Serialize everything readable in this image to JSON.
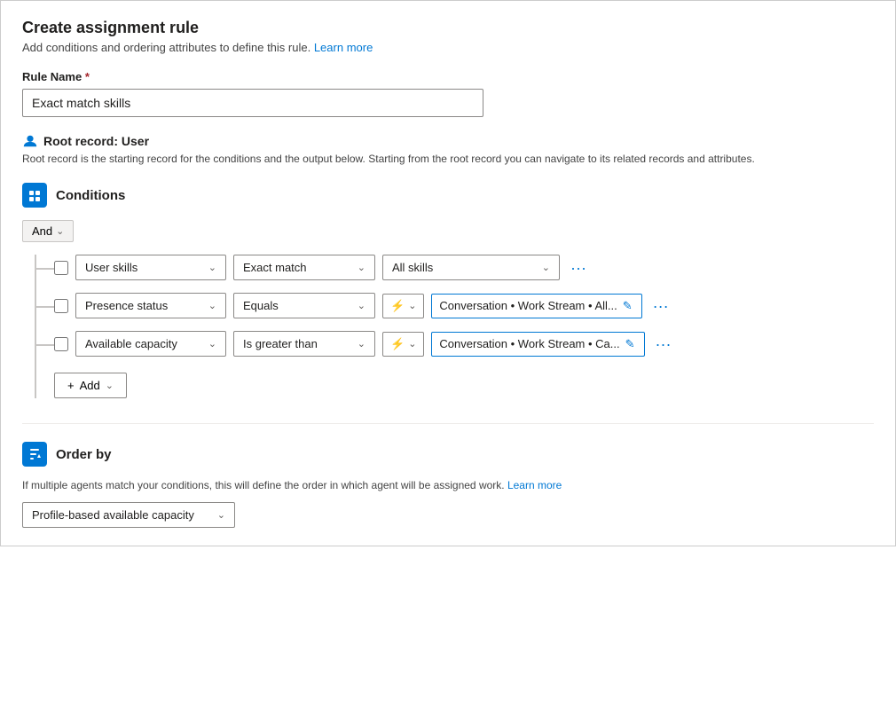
{
  "page": {
    "title": "Create assignment rule",
    "subtitle": "Add conditions and ordering attributes to define this rule.",
    "learn_more_link": "Learn more"
  },
  "rule_name": {
    "label": "Rule Name",
    "required_marker": "*",
    "value": "Exact match skills",
    "placeholder": "Rule Name"
  },
  "root_record": {
    "label": "Root record: User",
    "description": "Root record is the starting record for the conditions and the output below. Starting from the root record you can navigate to its related records and attributes."
  },
  "conditions": {
    "section_title": "Conditions",
    "and_label": "And",
    "rows": [
      {
        "field": "User skills",
        "operator": "Exact match",
        "value": "All skills",
        "value_type": "dropdown"
      },
      {
        "field": "Presence status",
        "operator": "Equals",
        "value": "Conversation • Work Stream • All...",
        "value_type": "lightning"
      },
      {
        "field": "Available capacity",
        "operator": "Is greater than",
        "value": "Conversation • Work Stream • Ca...",
        "value_type": "lightning"
      }
    ],
    "add_label": "Add"
  },
  "order_by": {
    "section_title": "Order by",
    "description": "If multiple agents match your conditions, this will define the order in which agent will be assigned work.",
    "learn_more": "Learn more",
    "value": "Profile-based available capacity"
  }
}
